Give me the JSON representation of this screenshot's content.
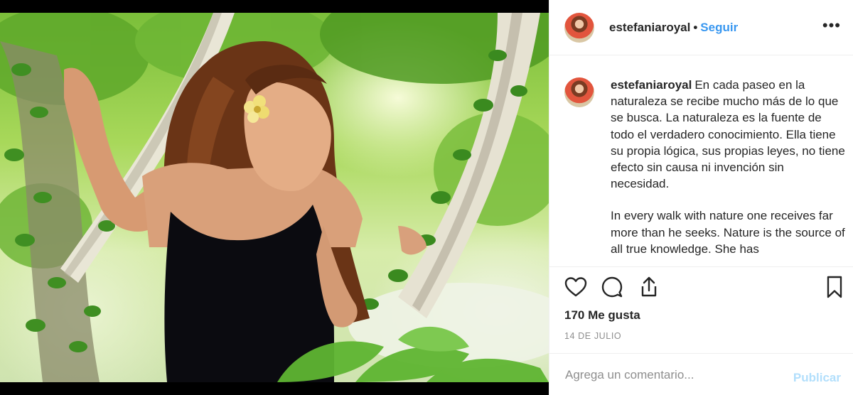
{
  "post": {
    "username": "estefaniaroyal",
    "separator": "•",
    "follow_label": "Seguir",
    "more_label": "•••"
  },
  "caption": {
    "username": "estefaniaroyal",
    "paragraph_es": "En cada paseo en la naturaleza se recibe mucho más de lo que se busca. La naturaleza es la fuente de todo el verdadero conocimiento. Ella tiene su propia lógica, sus propias leyes, no tiene efecto sin causa ni invención sin necesidad.",
    "paragraph_en": "In every walk with nature one receives far more than he seeks. Nature is the source of all true knowledge. She has"
  },
  "actions": {
    "like_icon": "heart-icon",
    "comment_icon": "comment-icon",
    "share_icon": "share-icon",
    "save_icon": "bookmark-icon"
  },
  "stats": {
    "likes": "170 Me gusta",
    "date": "14 DE JULIO"
  },
  "comment": {
    "placeholder": "Agrega un comentario...",
    "publish_label": "Publicar"
  },
  "colors": {
    "link_blue": "#3897f0",
    "publish_disabled": "#b2dffc",
    "text_dark": "#262626",
    "text_muted": "#8e8e8e"
  }
}
